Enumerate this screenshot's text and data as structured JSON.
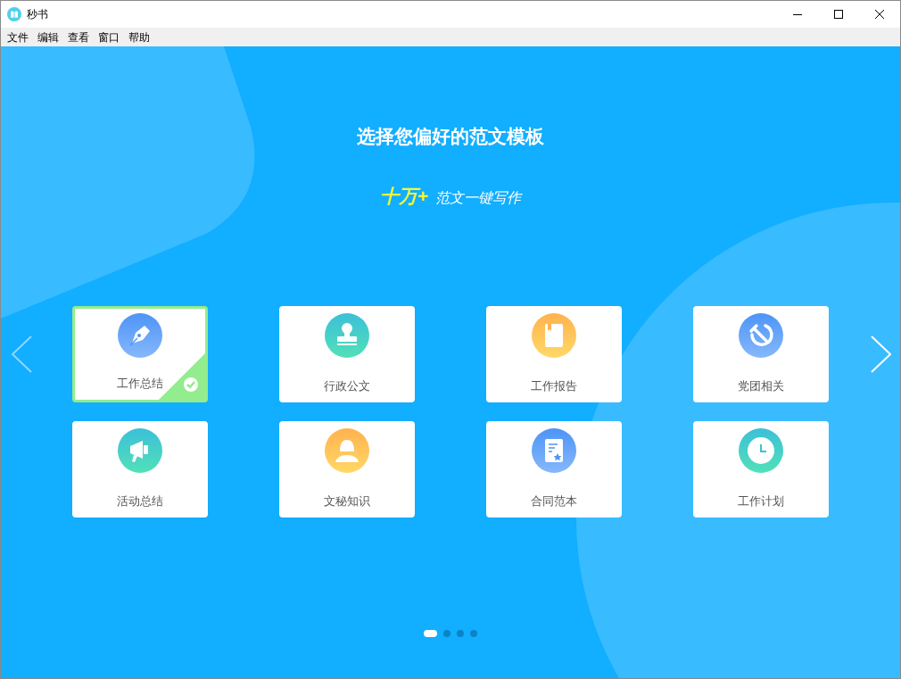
{
  "window": {
    "title": "秒书"
  },
  "menu": [
    "文件",
    "编辑",
    "查看",
    "窗口",
    "帮助"
  ],
  "heading": "选择您偏好的范文模板",
  "slogan": {
    "highlight": "十万+",
    "text": "范文一键写作"
  },
  "templates": [
    {
      "label": "工作总结",
      "kind": "pen",
      "selected": true
    },
    {
      "label": "行政公文",
      "kind": "stamp",
      "selected": false
    },
    {
      "label": "工作报告",
      "kind": "book",
      "selected": false
    },
    {
      "label": "党团相关",
      "kind": "emblem",
      "selected": false
    },
    {
      "label": "活动总结",
      "kind": "megaphone",
      "selected": false
    },
    {
      "label": "文秘知识",
      "kind": "person",
      "selected": false
    },
    {
      "label": "合同范本",
      "kind": "document",
      "selected": false
    },
    {
      "label": "工作计划",
      "kind": "clock",
      "selected": false
    }
  ],
  "pages": [
    {
      "selected": true
    },
    {
      "selected": false
    },
    {
      "selected": false
    },
    {
      "selected": false
    }
  ]
}
